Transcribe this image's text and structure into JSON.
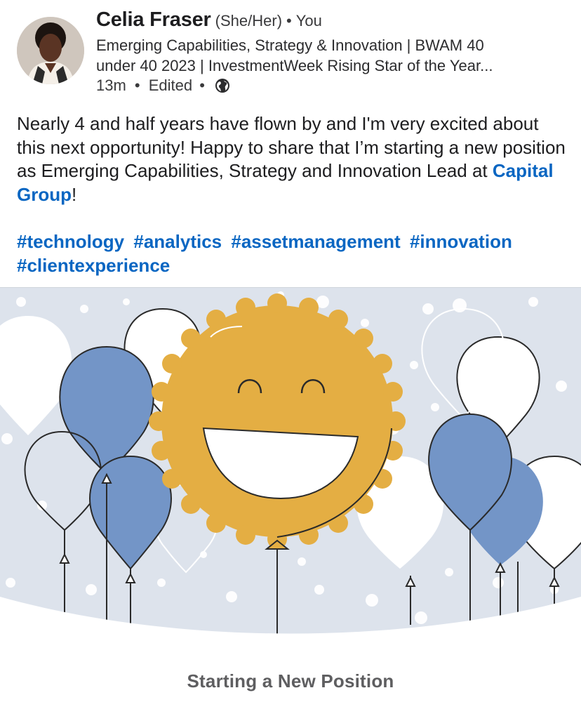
{
  "author": {
    "name": "Celia Fraser",
    "pronouns": "(She/Her)",
    "separator": "•",
    "relation": "You",
    "headline_line1": "Emerging Capabilities, Strategy & Innovation | BWAM 40",
    "headline_line2": "under 40 2023 | InvestmentWeek Rising Star of the Year...",
    "avatar_icon": "profile-photo"
  },
  "meta": {
    "time": "13m",
    "separator": "•",
    "edited": "Edited",
    "visibility_icon": "globe-icon"
  },
  "post": {
    "text_before_mention": "Nearly 4 and half years have flown by and I'm very excited about this next opportunity! Happy to share that I’m starting a new position as Emerging Capabilities, Strategy and Innovation Lead at ",
    "mention": "Capital Group",
    "text_after_mention": "!",
    "hashtags": [
      "#technology",
      "#analytics",
      "#assetmanagement",
      "#innovation",
      "#clientexperience"
    ]
  },
  "card": {
    "image_icon": "celebration-balloons-smiley-illustration",
    "caption": "Starting a New Position"
  },
  "colors": {
    "link": "#0a66c2",
    "balloon_blue": "#7395c7",
    "smiley_gold": "#e4ae43",
    "background": "#dde3ec"
  }
}
